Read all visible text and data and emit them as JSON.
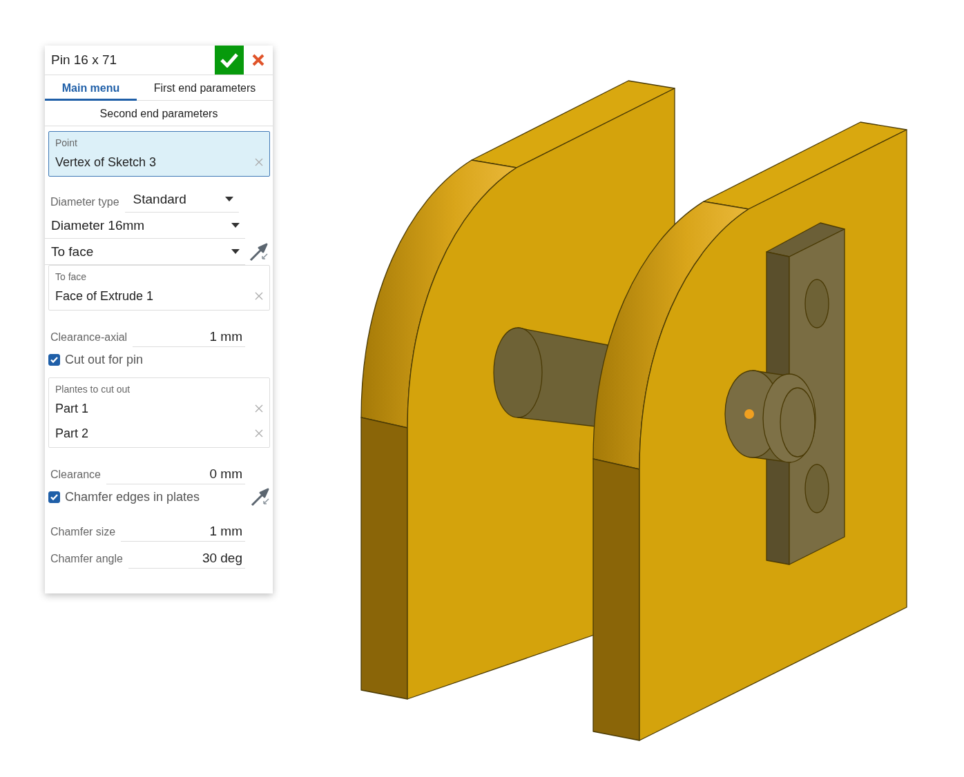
{
  "dialog": {
    "title": "Pin 16 x 71"
  },
  "tabs": [
    {
      "label": "Main menu",
      "selected": true
    },
    {
      "label": "First end parameters",
      "selected": false
    },
    {
      "label": "Second end parameters",
      "selected": false
    }
  ],
  "rows": [
    {
      "kind": "query",
      "label": "Point",
      "selected": true,
      "items": [
        "Vertex of Sketch 3"
      ]
    },
    {
      "kind": "select",
      "label": "Diameter type",
      "value": "Standard"
    },
    {
      "kind": "select",
      "value": "Diameter 16mm"
    },
    {
      "kind": "select",
      "value": "To face",
      "flip": true
    },
    {
      "kind": "query",
      "label": "To face",
      "selected": false,
      "items": [
        "Face of Extrude 1"
      ]
    },
    {
      "kind": "field",
      "label": "Clearance-axial",
      "value": "1 mm"
    },
    {
      "kind": "checkbox",
      "label": "Cut out for pin",
      "checked": true
    },
    {
      "kind": "query",
      "label": "Plantes to cut out",
      "selected": false,
      "items": [
        "Part 1",
        "Part 2"
      ]
    },
    {
      "kind": "field",
      "label": "Clearance",
      "value": "0 mm"
    },
    {
      "kind": "checkbox",
      "label": "Chamfer edges in plates",
      "checked": true,
      "flip": true
    },
    {
      "kind": "field",
      "label": "Chamfer size",
      "value": "1 mm"
    },
    {
      "kind": "field",
      "label": "Chamfer angle",
      "value": "30 deg"
    }
  ]
}
